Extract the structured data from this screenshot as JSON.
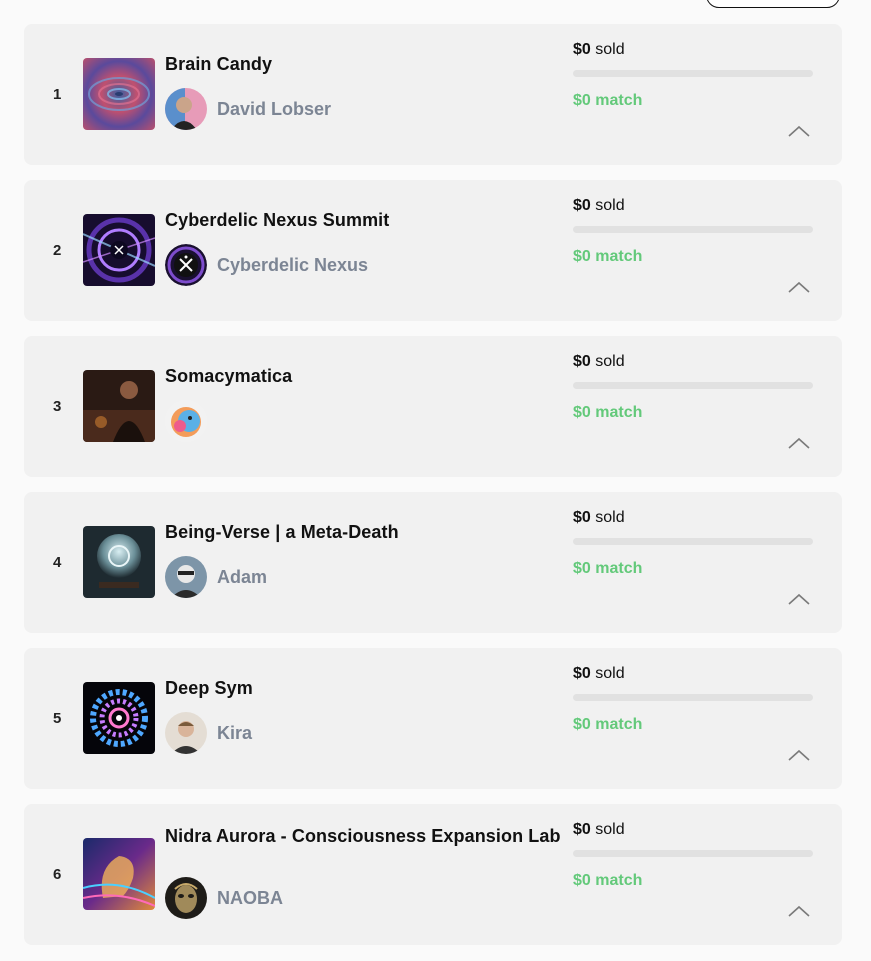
{
  "projects": [
    {
      "rank": "1",
      "title": "Brain Candy",
      "creator": "David Lobser",
      "sold_amount": "$0",
      "sold_label": "sold",
      "match_text": "$0 match",
      "thumb_icon": "psychedelic-tunnel-image",
      "avatar_icon": "person-avatar"
    },
    {
      "rank": "2",
      "title": "Cyberdelic Nexus Summit",
      "creator": "Cyberdelic Nexus",
      "sold_amount": "$0",
      "sold_label": "sold",
      "match_text": "$0 match",
      "thumb_icon": "nexus-portal-image",
      "avatar_icon": "nexus-logo-avatar"
    },
    {
      "rank": "3",
      "title": "Somacymatica",
      "creator": "",
      "sold_amount": "$0",
      "sold_label": "sold",
      "match_text": "$0 match",
      "thumb_icon": "performer-photo-image",
      "avatar_icon": "colorful-face-avatar"
    },
    {
      "rank": "4",
      "title": "Being-Verse | a Meta-Death",
      "creator": "Adam",
      "sold_amount": "$0",
      "sold_label": "sold",
      "match_text": "$0 match",
      "thumb_icon": "crystal-sculpture-image",
      "avatar_icon": "person-avatar"
    },
    {
      "rank": "5",
      "title": "Deep Sym",
      "creator": "Kira",
      "sold_amount": "$0",
      "sold_label": "sold",
      "match_text": "$0 match",
      "thumb_icon": "mandala-lights-image",
      "avatar_icon": "person-avatar"
    },
    {
      "rank": "6",
      "title": "Nidra Aurora - Consciousness Expansion Lab",
      "creator": "NAOBA",
      "sold_amount": "$0",
      "sold_label": "sold",
      "match_text": "$0 match",
      "thumb_icon": "cosmic-head-image",
      "avatar_icon": "mask-avatar"
    }
  ],
  "colors": {
    "match_green": "#63c97a",
    "creator_gray": "#7c8594",
    "card_bg": "#f1f1f1"
  }
}
